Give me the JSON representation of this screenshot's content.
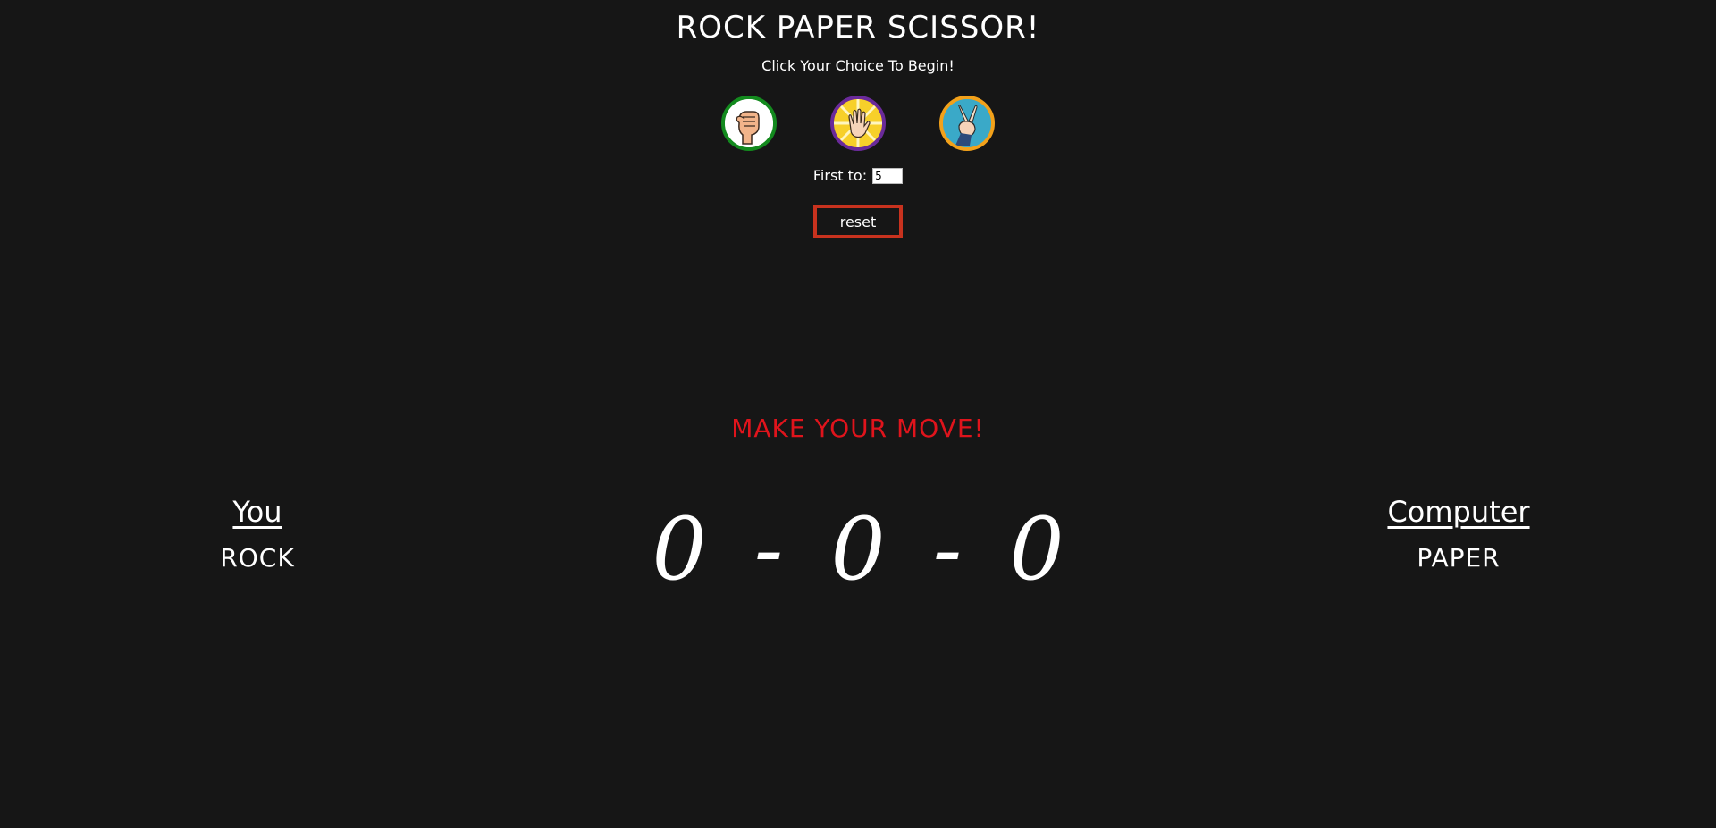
{
  "title": "ROCK PAPER SCISSOR!",
  "subtitle": "Click Your Choice To Begin!",
  "choices": [
    {
      "name": "rock",
      "icon": "fist-icon",
      "border_color": "#138a1e",
      "bg": "#ffffff"
    },
    {
      "name": "paper",
      "icon": "open-hand-icon",
      "border_color": "#6a2a9a",
      "bg": "#f2c21a"
    },
    {
      "name": "scissor",
      "icon": "scissors-hand-icon",
      "border_color": "#f2a11a",
      "bg": "#3aa9c8"
    }
  ],
  "first_to": {
    "label": "First to:",
    "value": "5"
  },
  "reset_label": "reset",
  "message": "MAKE YOUR MOVE!",
  "players": {
    "you": {
      "name": "You",
      "move": "ROCK"
    },
    "computer": {
      "name": "Computer",
      "move": "PAPER"
    }
  },
  "score": {
    "you": "0",
    "ties": "0",
    "computer": "0",
    "separator": "-"
  },
  "colors": {
    "background": "#161616",
    "message": "#e0141c",
    "reset_border": "#c8321e"
  }
}
